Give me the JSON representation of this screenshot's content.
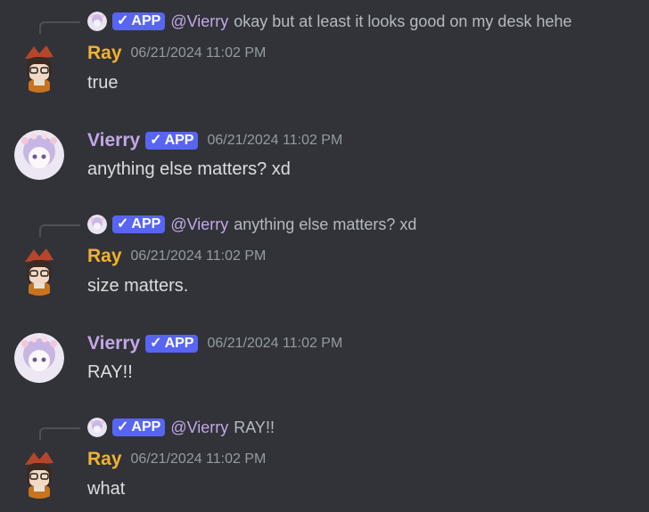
{
  "badge": {
    "label": "APP",
    "check": "✓"
  },
  "messages": [
    {
      "author": "Ray",
      "timestamp": "06/21/2024 11:02 PM",
      "text": "true",
      "reply": {
        "author": "@Vierry",
        "text": "okay but at least it looks good on my desk hehe"
      }
    },
    {
      "author": "Vierry",
      "timestamp": "06/21/2024 11:02 PM",
      "text": "anything else matters? xd"
    },
    {
      "author": "Ray",
      "timestamp": "06/21/2024 11:02 PM",
      "text": "size matters.",
      "reply": {
        "author": "@Vierry",
        "text": "anything else matters? xd"
      }
    },
    {
      "author": "Vierry",
      "timestamp": "06/21/2024 11:02 PM",
      "text": "RAY!!"
    },
    {
      "author": "Ray",
      "timestamp": "06/21/2024 11:02 PM",
      "text": "what",
      "reply": {
        "author": "@Vierry",
        "text": "RAY!!"
      }
    }
  ]
}
